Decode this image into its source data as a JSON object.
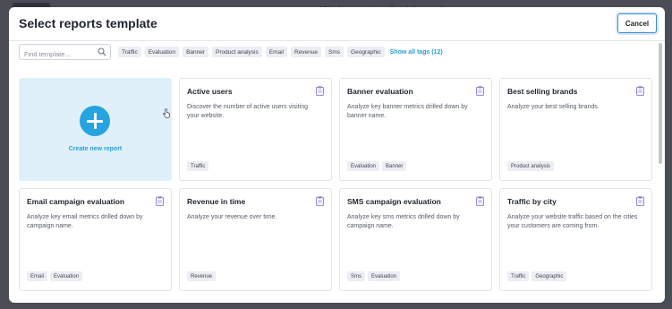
{
  "backdrop": {
    "title": "Welcome to dashboards"
  },
  "modal": {
    "title": "Select reports template",
    "cancel_label": "Cancel"
  },
  "filter": {
    "search_placeholder": "Find template...",
    "tags": [
      "Traffic",
      "Evaluation",
      "Banner",
      "Product analysis",
      "Email",
      "Revenue",
      "Sms",
      "Geographic"
    ],
    "show_all_label": "Show all tags (12)"
  },
  "create_card": {
    "label": "Create new report"
  },
  "cards": [
    {
      "title": "Active users",
      "description": "Discover the number of active users visiting your website.",
      "tags": [
        "Traffic"
      ]
    },
    {
      "title": "Banner evaluation",
      "description": "Analyze key banner metrics drilled down by banner name.",
      "tags": [
        "Evaluation",
        "Banner"
      ]
    },
    {
      "title": "Best selling brands",
      "description": "Analyze your best selling brands.",
      "tags": [
        "Product analysis"
      ]
    },
    {
      "title": "Email campaign evaluation",
      "description": "Analyze key email metrics drilled down by campaign name.",
      "tags": [
        "Email",
        "Evaluation"
      ]
    },
    {
      "title": "Revenue in time",
      "description": "Analyze your revenue over time.",
      "tags": [
        "Revenue"
      ]
    },
    {
      "title": "SMS campaign evaluation",
      "description": "Analyze key sms metrics drilled down by campaign name.",
      "tags": [
        "Sms",
        "Evaluation"
      ]
    },
    {
      "title": "Traffic by city",
      "description": "Analyze your website traffic based on the cities your customers are coming from.",
      "tags": [
        "Traffic",
        "Geographic"
      ]
    }
  ],
  "colors": {
    "accent": "#26a4df",
    "create_card_bg": "#dff0fa",
    "clipboard_icon": "#8a7fd6"
  }
}
